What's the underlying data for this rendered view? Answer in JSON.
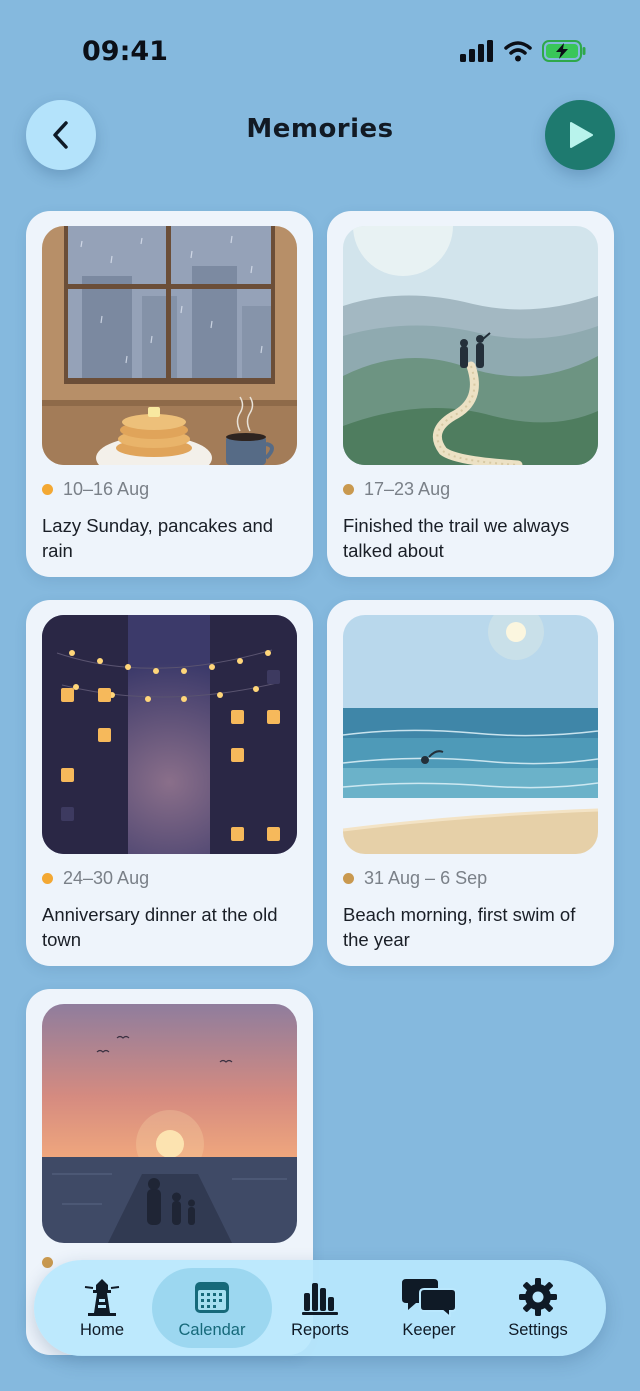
{
  "status_bar": {
    "time": "09:41"
  },
  "header": {
    "title": "Memories",
    "back_icon": "chevron-left-icon",
    "play_icon": "play-icon"
  },
  "colors": {
    "background": "#85b9de",
    "accent": "#1e7a6f",
    "dot_yellow": "#f3a833",
    "dot_tan": "#c9994f"
  },
  "memories": [
    {
      "date": "10–16 Aug",
      "caption": "Lazy Sunday, pancakes and rain",
      "dot_color": "#f3a833",
      "image": "rainy-window-pancakes"
    },
    {
      "date": "17–23 Aug",
      "caption": "Finished the trail we always talked about",
      "dot_color": "#c9994f",
      "image": "hills-trail"
    },
    {
      "date": "24–30 Aug",
      "caption": "Anniversary dinner at the old town",
      "dot_color": "#f3a833",
      "image": "night-street-lights"
    },
    {
      "date": "31 Aug – 6 Sep",
      "caption": "Beach morning, first swim of the year",
      "dot_color": "#c9994f",
      "image": "beach-swim"
    },
    {
      "date": "",
      "caption": "",
      "dot_color": "#c9994f",
      "image": "sunset-pier"
    }
  ],
  "tabs": [
    {
      "label": "Home",
      "icon": "lighthouse-icon",
      "active": false
    },
    {
      "label": "Calendar",
      "icon": "calendar-icon",
      "active": true
    },
    {
      "label": "Reports",
      "icon": "bar-chart-icon",
      "active": false
    },
    {
      "label": "Keeper",
      "icon": "chat-bubbles-icon",
      "active": false
    },
    {
      "label": "Settings",
      "icon": "gear-icon",
      "active": false
    }
  ]
}
